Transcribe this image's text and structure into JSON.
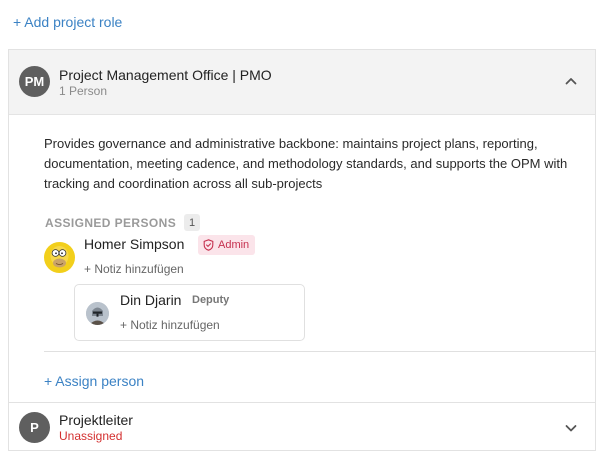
{
  "add_project_role": "+ Add project role",
  "roles": [
    {
      "initials": "PM",
      "title": "Project Management Office | PMO",
      "subtitle": "1 Person",
      "description": "Provides governance and administrative backbone: maintains project plans, reporting, documentation, meeting cadence, and methodology standards, and supports the OPM with tracking and coordination across all sub-projects",
      "assigned_label": "ASSIGNED PERSONS",
      "assigned_count": "1",
      "primary_person": {
        "name": "Homer Simpson",
        "badge": "Admin",
        "note_link": "+ Notiz hinzufügen"
      },
      "deputy_person": {
        "name": "Din Djarin",
        "tag": "Deputy",
        "note_link": "+ Notiz hinzufügen"
      },
      "assign_person": "+ Assign person"
    },
    {
      "initials": "P",
      "title": "Projektleiter",
      "subtitle": "Unassigned"
    }
  ],
  "colors": {
    "link": "#3b82c4",
    "admin_badge_bg": "#fbe4ea",
    "admin_badge_fg": "#c6304f",
    "unassigned": "#d32f2f"
  },
  "icons": {
    "collapse": "chevron-up-icon",
    "expand": "chevron-down-icon",
    "admin": "shield-icon"
  }
}
